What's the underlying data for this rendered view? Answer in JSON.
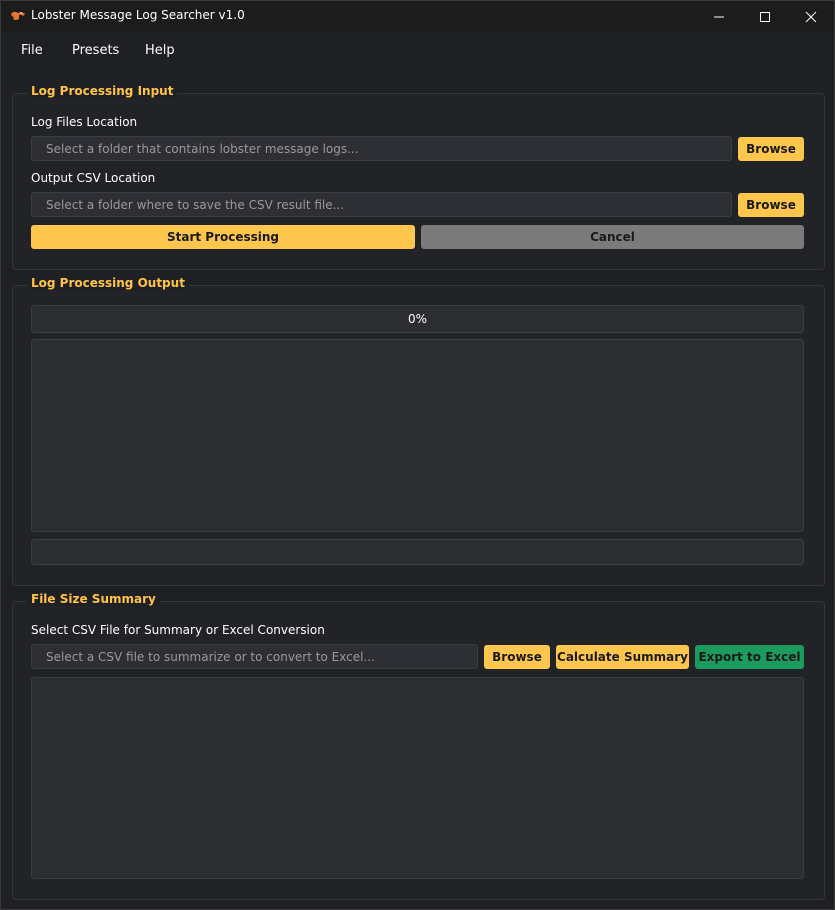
{
  "window": {
    "title": "Lobster Message Log Searcher v1.0",
    "icon": "lobster-icon",
    "controls": [
      "minimize-icon",
      "maximize-icon",
      "close-icon"
    ]
  },
  "menu": {
    "file": "File",
    "presets": "Presets",
    "help": "Help"
  },
  "input_section": {
    "title": "Log Processing Input",
    "log_files_label": "Log Files Location",
    "log_files_placeholder": "Select a folder that contains lobster message logs...",
    "log_files_value": "",
    "browse_label": "Browse",
    "output_label": "Output CSV Location",
    "output_placeholder": "Select a folder where to save the CSV result file...",
    "output_value": "",
    "start_label": "Start Processing",
    "cancel_label": "Cancel"
  },
  "output_section": {
    "title": "Log Processing Output",
    "progress_text": "0%",
    "progress_value": 0,
    "log_text": "",
    "status_text": ""
  },
  "summary_section": {
    "title": "File Size Summary",
    "csv_label": "Select CSV File for Summary or Excel Conversion",
    "csv_placeholder": "Select a CSV file to summarize or to convert to Excel...",
    "csv_value": "",
    "browse_label": "Browse",
    "calculate_label": "Calculate Summary",
    "export_label": "Export to Excel",
    "summary_text": ""
  },
  "colors": {
    "accent": "#ffc64d",
    "export": "#1b9b5e",
    "cancel": "#7b7b7b",
    "background": "#1f2024"
  }
}
